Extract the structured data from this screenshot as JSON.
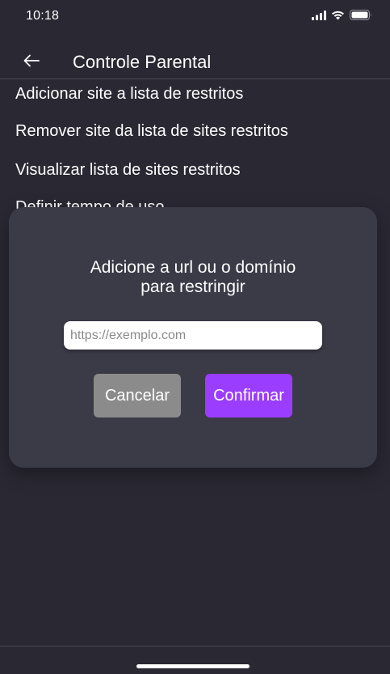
{
  "status_bar": {
    "time": "10:18",
    "icons": [
      "cellular-signal-icon",
      "wifi-icon",
      "battery-icon"
    ]
  },
  "header": {
    "back_icon": "arrow-left-icon",
    "title": "Controle Parental"
  },
  "menu": {
    "items": [
      {
        "label": "Adicionar site a lista de restritos"
      },
      {
        "label": "Remover site da lista de sites restritos"
      },
      {
        "label": "Visualizar lista de sites restritos"
      },
      {
        "label": "Definir tempo de uso"
      }
    ]
  },
  "dialog": {
    "title_line1": "Adicione a url ou o domínio",
    "title_line2": "para restringir",
    "input": {
      "value": "",
      "placeholder": "https://exemplo.com"
    },
    "cancel_label": "Cancelar",
    "confirm_label": "Confirmar"
  },
  "colors": {
    "background": "#2a2833",
    "dialog": "#3b3a47",
    "confirm_accent": "#9b3dff",
    "cancel": "#8b8b8b"
  }
}
